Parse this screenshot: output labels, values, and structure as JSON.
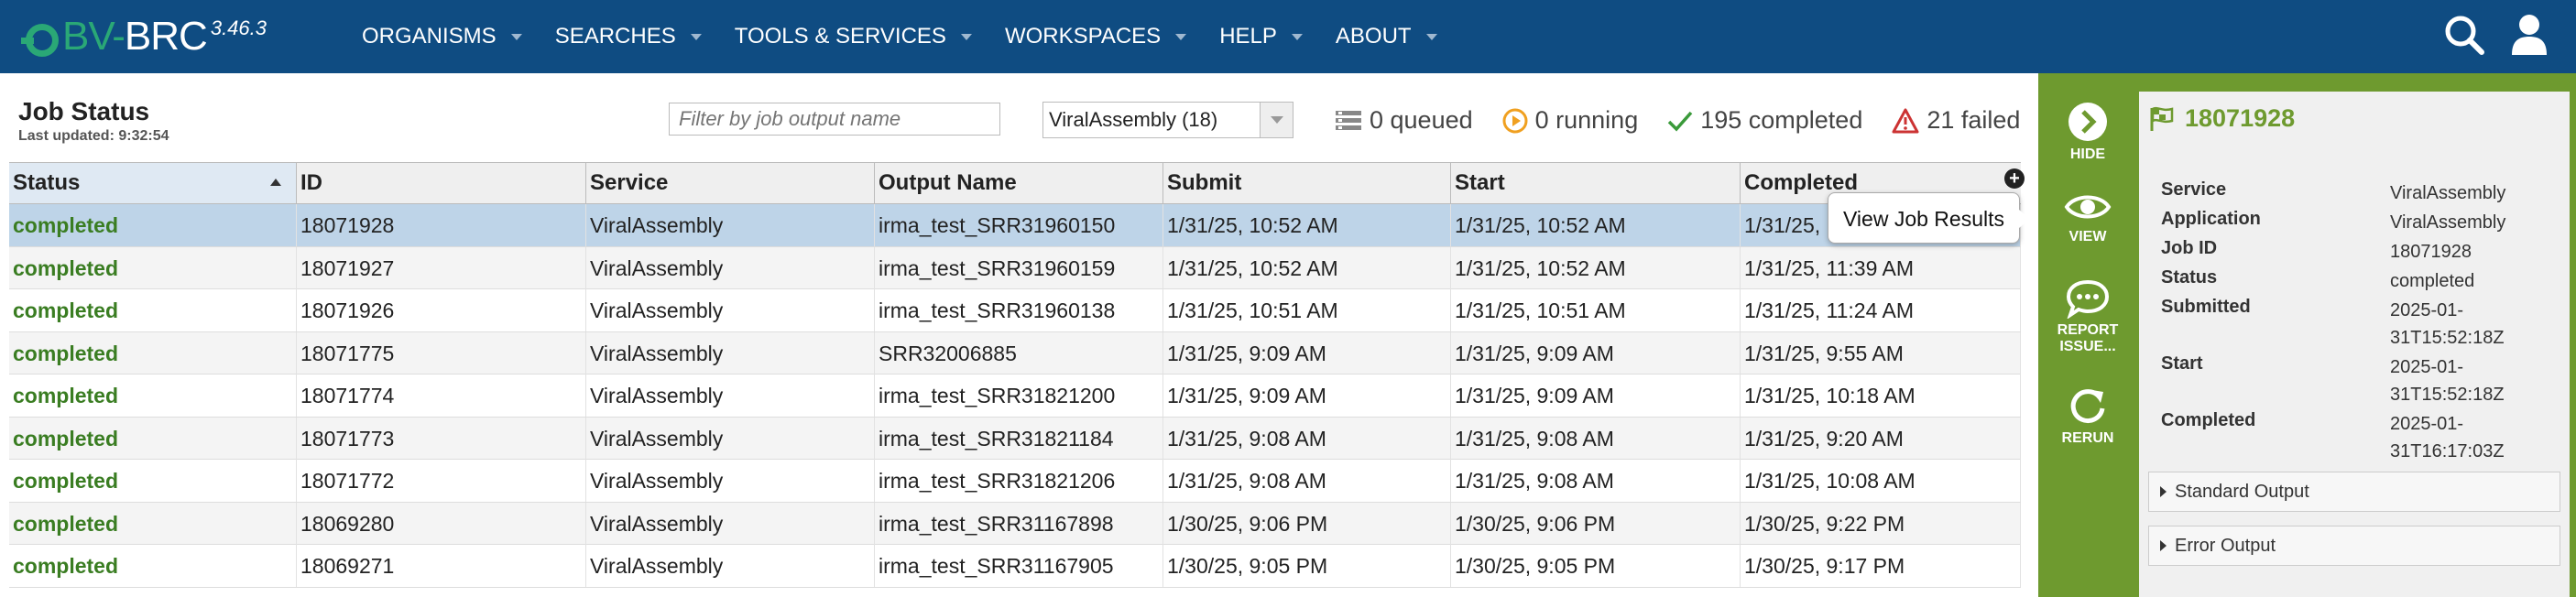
{
  "app": {
    "logo_prefix": "BV-",
    "logo_suffix": "BRC",
    "version": "3.46.3"
  },
  "nav": {
    "items": [
      "ORGANISMS",
      "SEARCHES",
      "TOOLS & SERVICES",
      "WORKSPACES",
      "HELP",
      "ABOUT"
    ]
  },
  "header": {
    "title": "Job Status",
    "last_updated": "Last updated: 9:32:54",
    "filter_placeholder": "Filter by job output name",
    "select_value": "ViralAssembly (18)"
  },
  "stats": {
    "queued": "0 queued",
    "running": "0 running",
    "completed": "195 completed",
    "failed": "21 failed"
  },
  "table": {
    "columns": [
      "Status",
      "ID",
      "Service",
      "Output Name",
      "Submit",
      "Start",
      "Completed"
    ],
    "rows": [
      [
        "completed",
        "18071928",
        "ViralAssembly",
        "irma_test_SRR31960150",
        "1/31/25, 10:52 AM",
        "1/31/25, 10:52 AM",
        "1/31/25,"
      ],
      [
        "completed",
        "18071927",
        "ViralAssembly",
        "irma_test_SRR31960159",
        "1/31/25, 10:52 AM",
        "1/31/25, 10:52 AM",
        "1/31/25, 11:39 AM"
      ],
      [
        "completed",
        "18071926",
        "ViralAssembly",
        "irma_test_SRR31960138",
        "1/31/25, 10:51 AM",
        "1/31/25, 10:51 AM",
        "1/31/25, 11:24 AM"
      ],
      [
        "completed",
        "18071775",
        "ViralAssembly",
        "SRR32006885",
        "1/31/25, 9:09 AM",
        "1/31/25, 9:09 AM",
        "1/31/25, 9:55 AM"
      ],
      [
        "completed",
        "18071774",
        "ViralAssembly",
        "irma_test_SRR31821200",
        "1/31/25, 9:09 AM",
        "1/31/25, 9:09 AM",
        "1/31/25, 10:18 AM"
      ],
      [
        "completed",
        "18071773",
        "ViralAssembly",
        "irma_test_SRR31821184",
        "1/31/25, 9:08 AM",
        "1/31/25, 9:08 AM",
        "1/31/25, 9:20 AM"
      ],
      [
        "completed",
        "18071772",
        "ViralAssembly",
        "irma_test_SRR31821206",
        "1/31/25, 9:08 AM",
        "1/31/25, 9:08 AM",
        "1/31/25, 10:08 AM"
      ],
      [
        "completed",
        "18069280",
        "ViralAssembly",
        "irma_test_SRR31167898",
        "1/30/25, 9:06 PM",
        "1/30/25, 9:06 PM",
        "1/30/25, 9:22 PM"
      ],
      [
        "completed",
        "18069271",
        "ViralAssembly",
        "irma_test_SRR31167905",
        "1/30/25, 9:05 PM",
        "1/30/25, 9:05 PM",
        "1/30/25, 9:17 PM"
      ]
    ]
  },
  "tooltip": "View Job Results",
  "actions": {
    "hide": "HIDE",
    "view": "VIEW",
    "report_1": "REPORT",
    "report_2": "ISSUE...",
    "rerun": "RERUN"
  },
  "detail": {
    "job_id_title": "18071928",
    "fields": [
      {
        "label": "Service",
        "value": "ViralAssembly"
      },
      {
        "label": "Application",
        "value": "ViralAssembly"
      },
      {
        "label": "Job ID",
        "value": "18071928"
      },
      {
        "label": "Status",
        "value": "completed"
      },
      {
        "label": "Submitted",
        "value": "2025-01-31T15:52:18Z"
      },
      {
        "label": "Start",
        "value": "2025-01-31T15:52:18Z"
      },
      {
        "label": "Completed",
        "value": "2025-01-31T16:17:03Z"
      }
    ],
    "standard_output": "Standard Output",
    "error_output": "Error Output"
  },
  "colors": {
    "nav_bg": "#0f4c82",
    "accent_green": "#6e9a2f",
    "status_green": "#3a7d22",
    "selected_row": "#bed4e8"
  }
}
